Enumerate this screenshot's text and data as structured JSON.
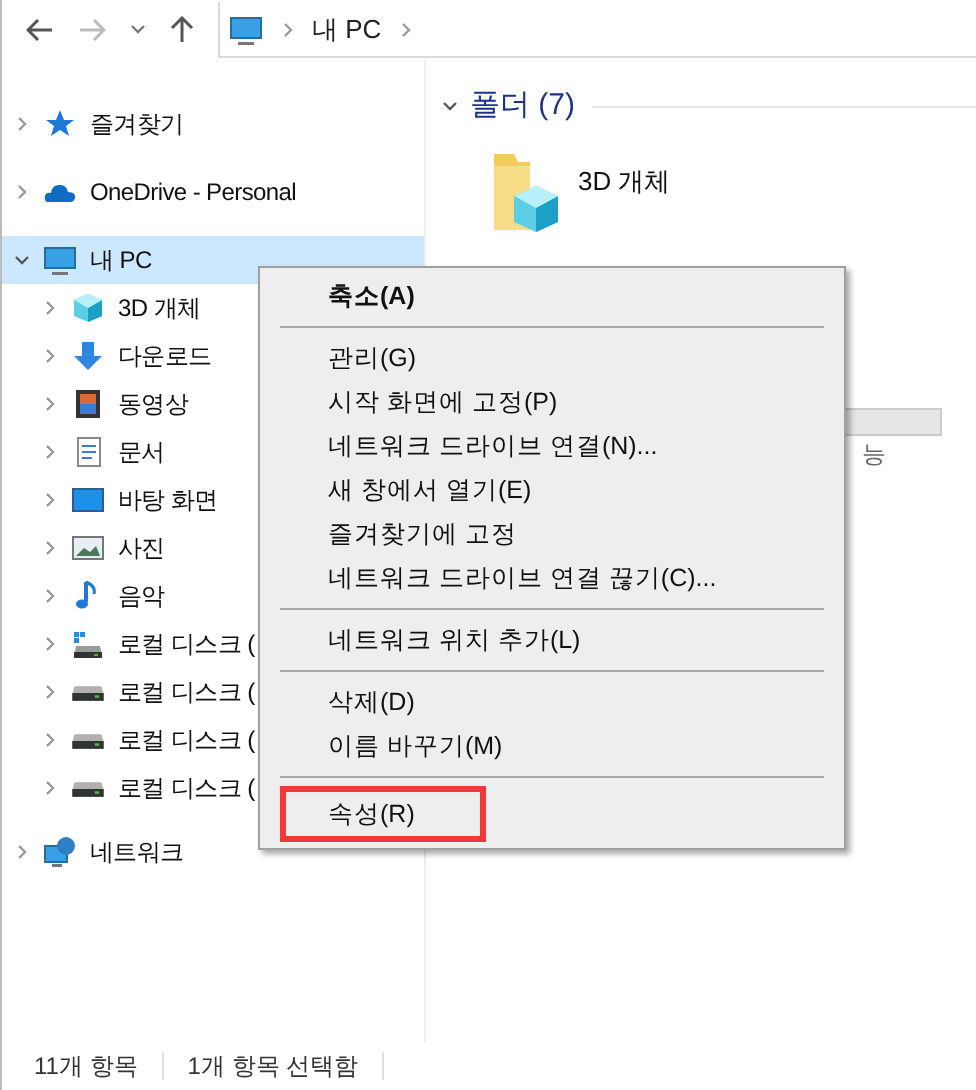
{
  "address_bar": {
    "path": [
      {
        "label": "내 PC"
      }
    ]
  },
  "sidebar": {
    "items": [
      {
        "label": "즐겨찾기",
        "kind": "star",
        "expanded": false,
        "selected": false
      },
      {
        "label": "OneDrive - Personal",
        "kind": "cloud",
        "expanded": false,
        "selected": false
      },
      {
        "label": "내 PC",
        "kind": "pc",
        "expanded": true,
        "selected": true,
        "children": [
          {
            "label": "3D 개체",
            "kind": "cube",
            "expanded": false,
            "selected": false
          },
          {
            "label": "다운로드",
            "kind": "download",
            "expanded": false,
            "selected": false
          },
          {
            "label": "동영상",
            "kind": "film",
            "expanded": false,
            "selected": false
          },
          {
            "label": "문서",
            "kind": "document",
            "expanded": false,
            "selected": false
          },
          {
            "label": "바탕 화면",
            "kind": "desktop",
            "expanded": false,
            "selected": false
          },
          {
            "label": "사진",
            "kind": "image",
            "expanded": false,
            "selected": false
          },
          {
            "label": "음악",
            "kind": "music",
            "expanded": false,
            "selected": false
          },
          {
            "label": "로컬 디스크 (",
            "kind": "system-drive",
            "expanded": false,
            "selected": false
          },
          {
            "label": "로컬 디스크 (",
            "kind": "drive",
            "expanded": false,
            "selected": false
          },
          {
            "label": "로컬 디스크 (",
            "kind": "drive",
            "expanded": false,
            "selected": false
          },
          {
            "label": "로컬 디스크 (",
            "kind": "drive",
            "expanded": false,
            "selected": false
          }
        ]
      },
      {
        "label": "네트워크",
        "kind": "network",
        "expanded": false,
        "selected": false
      }
    ]
  },
  "content": {
    "group": {
      "title": "폴더 (7)",
      "expanded": true
    },
    "items": [
      {
        "label": "3D 개체"
      }
    ],
    "partial_text": "능"
  },
  "context_menu": {
    "items": [
      {
        "kind": "item",
        "label": "축소(A)",
        "default": true,
        "highlighted": false
      },
      {
        "kind": "separator"
      },
      {
        "kind": "item",
        "label": "관리(G)",
        "default": false,
        "highlighted": false
      },
      {
        "kind": "item",
        "label": "시작 화면에 고정(P)",
        "default": false,
        "highlighted": false
      },
      {
        "kind": "item",
        "label": "네트워크 드라이브 연결(N)...",
        "default": false,
        "highlighted": false
      },
      {
        "kind": "item",
        "label": "새 창에서 열기(E)",
        "default": false,
        "highlighted": false
      },
      {
        "kind": "item",
        "label": "즐겨찾기에 고정",
        "default": false,
        "highlighted": false
      },
      {
        "kind": "item",
        "label": "네트워크 드라이브 연결 끊기(C)...",
        "default": false,
        "highlighted": false
      },
      {
        "kind": "separator"
      },
      {
        "kind": "item",
        "label": "네트워크 위치 추가(L)",
        "default": false,
        "highlighted": false
      },
      {
        "kind": "separator"
      },
      {
        "kind": "item",
        "label": "삭제(D)",
        "default": false,
        "highlighted": false
      },
      {
        "kind": "item",
        "label": "이름 바꾸기(M)",
        "default": false,
        "highlighted": false
      },
      {
        "kind": "separator"
      },
      {
        "kind": "item",
        "label": "속성(R)",
        "default": false,
        "highlighted": true
      }
    ]
  },
  "status_bar": {
    "items": [
      "11개 항목",
      "1개 항목 선택함"
    ]
  }
}
